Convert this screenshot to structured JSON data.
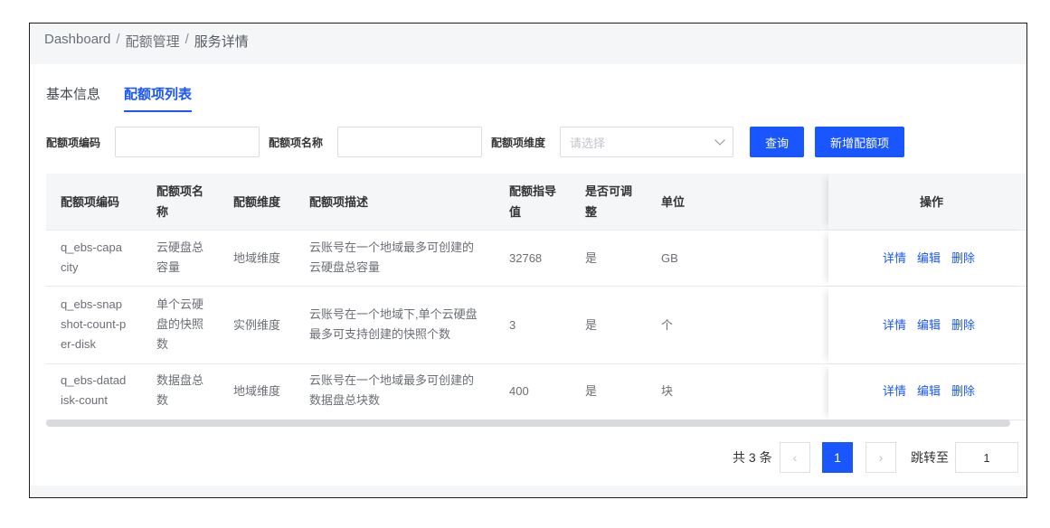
{
  "breadcrumb": {
    "items": [
      "Dashboard",
      "配额管理",
      "服务详情"
    ],
    "separator": "/"
  },
  "tabs": [
    {
      "label": "基本信息",
      "active": false
    },
    {
      "label": "配额项列表",
      "active": true
    }
  ],
  "filters": {
    "code_label": "配额项编码",
    "code_value": "",
    "name_label": "配额项名称",
    "name_value": "",
    "dimension_label": "配额项维度",
    "dimension_placeholder": "请选择",
    "query_button": "查询",
    "add_button": "新增配额项"
  },
  "table": {
    "headers": {
      "code": "配额项编码",
      "name": [
        "配额项名",
        "称"
      ],
      "dimension": "配额维度",
      "desc": "配额项描述",
      "guide": [
        "配额指导",
        "值"
      ],
      "adjustable": [
        "是否可调",
        "整"
      ],
      "unit": "单位",
      "ops": "操作"
    },
    "rows": [
      {
        "code": [
          "q_ebs-capa",
          "city"
        ],
        "name": [
          "云硬盘总",
          "容量"
        ],
        "dimension": "地域维度",
        "desc": [
          "云账号在一个地域最多可创建的",
          "云硬盘总容量"
        ],
        "guide": "32768",
        "adjustable": "是",
        "unit": "GB"
      },
      {
        "code": [
          "q_ebs-snap",
          "shot-count-p",
          "er-disk"
        ],
        "name": [
          "单个云硬",
          "盘的快照",
          "数"
        ],
        "dimension": "实例维度",
        "desc": [
          "云账号在一个地域下,单个云硬盘",
          "最多可支持创建的快照个数"
        ],
        "guide": "3",
        "adjustable": "是",
        "unit": "个"
      },
      {
        "code": [
          "q_ebs-datad",
          "isk-count"
        ],
        "name": [
          "数据盘总",
          "数"
        ],
        "dimension": "地域维度",
        "desc": [
          "云账号在一个地域最多可创建的",
          "数据盘总块数"
        ],
        "guide": "400",
        "adjustable": "是",
        "unit": "块"
      }
    ],
    "actions": {
      "detail": "详情",
      "edit": "编辑",
      "delete": "删除"
    }
  },
  "pagination": {
    "total": "共 3 条",
    "prev_icon": "‹",
    "next_icon": "›",
    "current_page": "1",
    "jump_label": "跳转至",
    "jump_value": "1"
  },
  "colors": {
    "primary": "#1a56ff",
    "header_bg": "#f5f6f8"
  }
}
